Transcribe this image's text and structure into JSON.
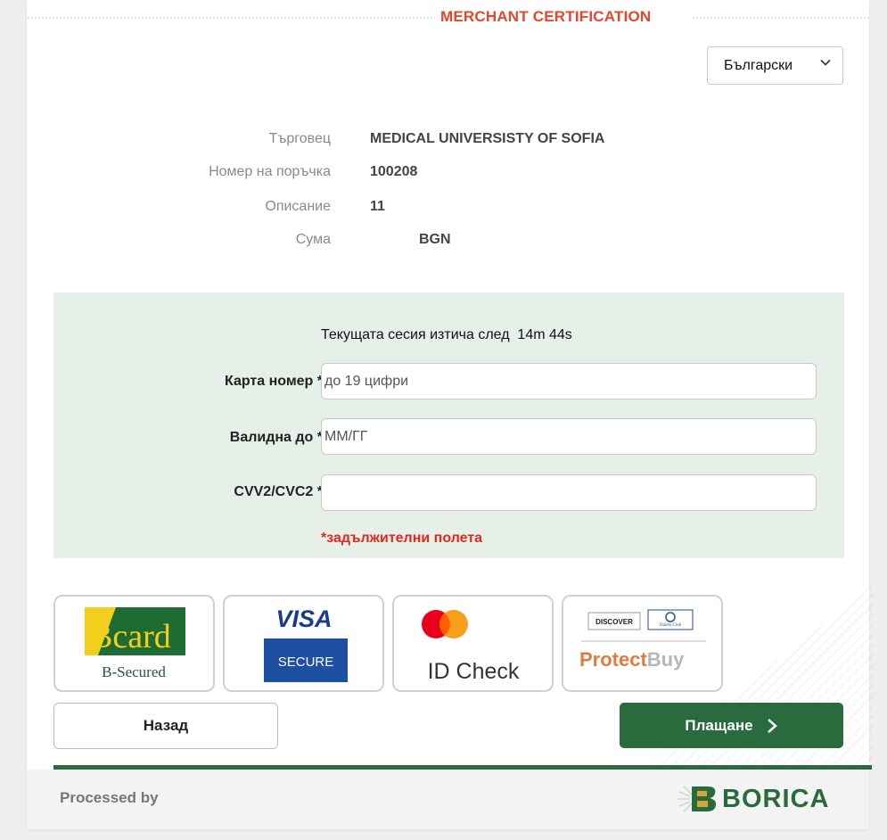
{
  "header": {
    "title": "MERCHANT CERTIFICATION"
  },
  "language": {
    "selected": "Български"
  },
  "order_info": [
    {
      "label": "Търговец",
      "value": "MEDICAL UNIVERSISTY OF SOFIA"
    },
    {
      "label": "Номер на поръчка",
      "value": "100208"
    },
    {
      "label": "Описание",
      "value": "11"
    },
    {
      "label": "Сума",
      "value": "BGN"
    }
  ],
  "form": {
    "session_text": "Текущата сесия изтича след  14m 44s",
    "card_number": {
      "label": "Карта номер *",
      "placeholder": "до 19 цифри",
      "value": ""
    },
    "expiry": {
      "label": "Валидна до *",
      "placeholder": "ММ/ГГ",
      "value": ""
    },
    "cvv": {
      "label": "CVV2/CVC2 *",
      "placeholder": "",
      "value": ""
    },
    "required_note": "*задължителни полета"
  },
  "badges": {
    "bcard": {
      "logo_text": "Bcard",
      "caption": "B-Secured"
    },
    "visa": {
      "logo_text": "VISA",
      "caption": "SECURE"
    },
    "mastercard": {
      "caption": "ID Check"
    },
    "protectbuy": {
      "logo_text_1": "DISCOVER",
      "logo_text_2": "Diners Club",
      "caption_1": "Protect",
      "caption_2": "Buy"
    }
  },
  "buttons": {
    "back": "Назад",
    "pay": "Плащане"
  },
  "footer": {
    "processed_by": "Processed by",
    "logo_text": "BORICA"
  },
  "colors": {
    "brand_green": "#2a6b3d",
    "accent_red": "#e8452c",
    "required_red": "#e02a20",
    "panel_bg": "#e6efe8"
  },
  "icons": {
    "language_chevron": "chevron-down-icon",
    "pay_arrow": "chevron-right-icon"
  }
}
